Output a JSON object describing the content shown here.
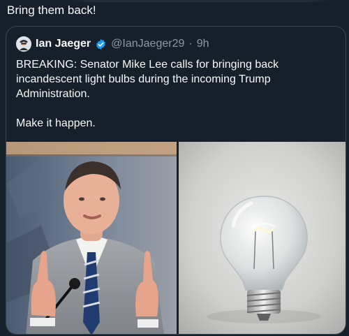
{
  "post": {
    "text": "Bring them back!"
  },
  "quoted_tweet": {
    "author_name": "Ian Jaeger",
    "handle": "@IanJaeger29",
    "separator": "·",
    "time": "9h",
    "paragraphs": [
      "BREAKING: Senator Mike Lee calls for bringing back incandescent light bulbs during the incoming Trump Administration.",
      "Make it happen."
    ]
  },
  "media": {
    "left_image": "photo-of-senator-speaking",
    "right_image": "incandescent-light-bulb-photo"
  },
  "colors": {
    "background": "#15202b",
    "border": "#38444d",
    "secondary_text": "#8b98a5",
    "verified_blue": "#1d9bf0"
  },
  "icons": {
    "verified": "verified-badge-icon",
    "avatar": "avatar-icon"
  }
}
